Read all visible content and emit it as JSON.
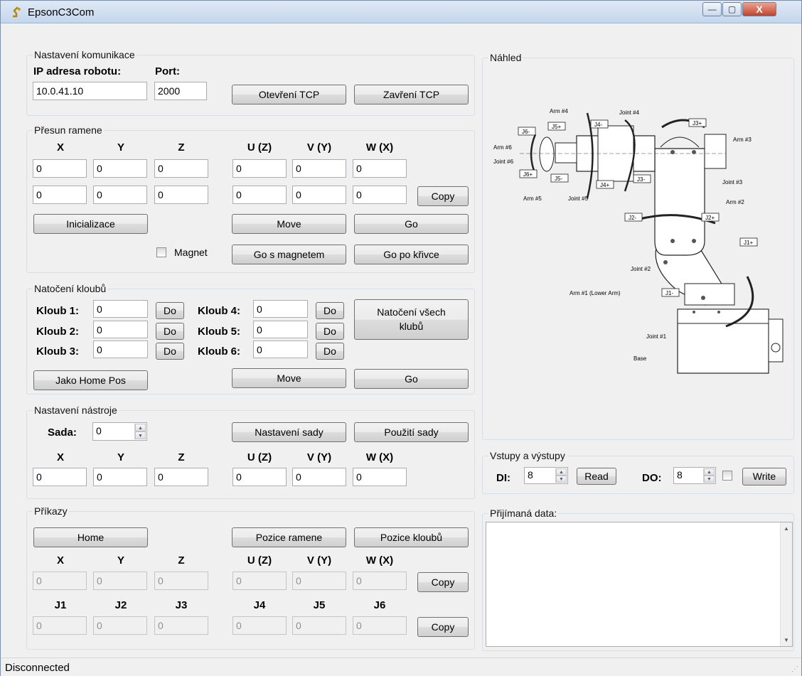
{
  "window": {
    "title": "EpsonC3Com",
    "minimize": "—",
    "maximize": "▢",
    "close": "X"
  },
  "comm": {
    "group": "Nastavení komunikace",
    "ip_label": "IP adresa robotu:",
    "port_label": "Port:",
    "ip_value": "10.0.41.10",
    "port_value": "2000",
    "open_btn": "Otevření TCP",
    "close_btn": "Zavření TCP"
  },
  "move": {
    "group": "Přesun ramene",
    "headers": [
      "X",
      "Y",
      "Z",
      "U (Z)",
      "V (Y)",
      "W (X)"
    ],
    "row1": [
      "0",
      "0",
      "0",
      "0",
      "0",
      "0"
    ],
    "row2": [
      "0",
      "0",
      "0",
      "0",
      "0",
      "0"
    ],
    "copy_btn": "Copy",
    "init_btn": "Inicializace",
    "move_btn": "Move",
    "go_btn": "Go",
    "magnet_label": "Magnet",
    "go_magnet_btn": "Go s magnetem",
    "go_curve_btn": "Go po křivce"
  },
  "joints": {
    "group": "Natočení kloubů",
    "labels": [
      "Kloub 1:",
      "Kloub 2:",
      "Kloub 3:",
      "Kloub 4:",
      "Kloub 5:",
      "Kloub 6:"
    ],
    "values": [
      "0",
      "0",
      "0",
      "0",
      "0",
      "0"
    ],
    "do_btn": "Do",
    "all_btn": "Natočení všech klubů",
    "home_btn": "Jako Home Pos",
    "move_btn": "Move",
    "go_btn": "Go"
  },
  "tool": {
    "group": "Nastavení nástroje",
    "set_label": "Sada:",
    "set_value": "0",
    "set_btn": "Nastavení sady",
    "use_btn": "Použití sady",
    "headers": [
      "X",
      "Y",
      "Z",
      "U (Z)",
      "V (Y)",
      "W (X)"
    ],
    "values": [
      "0",
      "0",
      "0",
      "0",
      "0",
      "0"
    ]
  },
  "commands": {
    "group": "Příkazy",
    "home_btn": "Home",
    "arm_pos_btn": "Pozice ramene",
    "joint_pos_btn": "Pozice kloubů",
    "headers": [
      "X",
      "Y",
      "Z",
      "U (Z)",
      "V (Y)",
      "W (X)"
    ],
    "values": [
      "0",
      "0",
      "0",
      "0",
      "0",
      "0"
    ],
    "joint_headers": [
      "J1",
      "J2",
      "J3",
      "J4",
      "J5",
      "J6"
    ],
    "joint_values": [
      "0",
      "0",
      "0",
      "0",
      "0",
      "0"
    ],
    "copy_btn": "Copy"
  },
  "preview": {
    "group": "Náhled",
    "tags": [
      "J6-",
      "J5+",
      "J4-",
      "J3+",
      "J6+",
      "J5-",
      "J4+",
      "J3-",
      "J2-",
      "J2+",
      "J1+",
      "J1-"
    ],
    "callouts": [
      "Arm #4",
      "Joint #4",
      "Arm #3",
      "Arm #6",
      "Joint #6",
      "Joint #3",
      "Arm #5",
      "Joint #5",
      "Arm #2",
      "Joint #2",
      "Arm #1 (Lower Arm)",
      "Joint #1",
      "Base"
    ]
  },
  "io": {
    "group": "Vstupy a výstupy",
    "di_label": "DI:",
    "di_value": "8",
    "read_btn": "Read",
    "do_label": "DO:",
    "do_value": "8",
    "write_btn": "Write"
  },
  "received": {
    "group": "Přijímaná data:"
  },
  "status": {
    "text": "Disconnected"
  },
  "colors": {
    "window_bg": "#f0f0f0",
    "title_bg": "#c4d6ec",
    "close_btn": "#c2422a"
  }
}
